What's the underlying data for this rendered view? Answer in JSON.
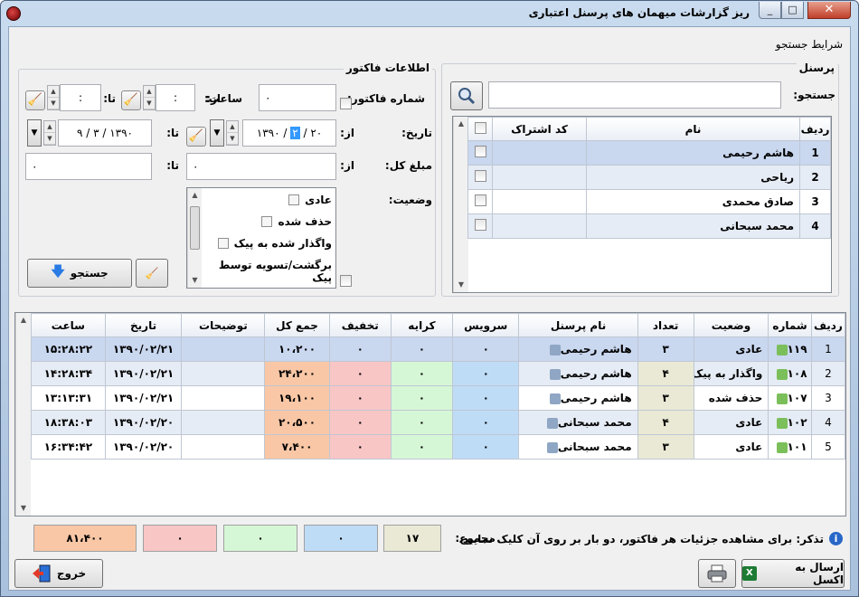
{
  "window": {
    "title": "ریز گزارشات میهمان های پرسنل اعتباری",
    "min": "_",
    "max": "□",
    "close": "✕"
  },
  "search_group": {
    "title": "شرایط جستجو"
  },
  "personnel": {
    "title": "پرسنل",
    "search_label": "جستجو:",
    "search_value": "",
    "columns": {
      "row": "ردیف",
      "name": "نام",
      "sub_code": "کد اشتراک"
    },
    "rows": [
      {
        "row": "1",
        "name": "هاشم رحیمی"
      },
      {
        "row": "2",
        "name": "ریاحی"
      },
      {
        "row": "3",
        "name": "صادق محمدی"
      },
      {
        "row": "4",
        "name": "محمد سبحانی"
      }
    ]
  },
  "invoice": {
    "title": "اطلاعات فاکتور",
    "number_label": "شماره فاکتور:",
    "number_value": "۰",
    "time_label": "ساعت:",
    "from_label": "از:",
    "to_label": "تا:",
    "time_from": ":",
    "time_to": ":",
    "date_label": "تاریخ:",
    "date_from_day": "۲۰",
    "date_from_month": "۲",
    "date_from_year": "۱۳۹۰",
    "date_to": "۹ / ۳ / ۱۳۹۰",
    "amount_label": "مبلغ کل:",
    "amount_from": "۰",
    "amount_to": "۰",
    "status_label": "وضعیت:",
    "status_options": [
      "عادی",
      "حذف شده",
      "واگذار شده به پیک",
      "برگشت/تسویه توسط پیک"
    ],
    "search_button": "جستجو"
  },
  "results": {
    "columns": [
      "ردیف",
      "شماره",
      "وضعیت",
      "تعداد",
      "نام پرسنل",
      "سرویس",
      "کرایه",
      "تخفیف",
      "جمع کل",
      "توضیحات",
      "تاریخ",
      "ساعت"
    ],
    "rows": [
      {
        "row": "1",
        "number": "۱۱۹",
        "status": "عادی",
        "count": "۳",
        "name": "هاشم رحیمی",
        "service": "۰",
        "fare": "۰",
        "discount": "۰",
        "total": "۱۰،۲۰۰",
        "desc": "",
        "date": "۱۳۹۰/۰۲/۲۱",
        "time": "۱۵:۲۸:۲۲"
      },
      {
        "row": "2",
        "number": "۱۰۸",
        "status": "واگذار به پیک",
        "count": "۴",
        "name": "هاشم رحیمی",
        "service": "۰",
        "fare": "۰",
        "discount": "۰",
        "total": "۲۴،۲۰۰",
        "desc": "",
        "date": "۱۳۹۰/۰۲/۲۱",
        "time": "۱۴:۲۸:۳۴"
      },
      {
        "row": "3",
        "number": "۱۰۷",
        "status": "حذف شده",
        "count": "۳",
        "name": "هاشم رحیمی",
        "service": "۰",
        "fare": "۰",
        "discount": "۰",
        "total": "۱۹،۱۰۰",
        "desc": "",
        "date": "۱۳۹۰/۰۲/۲۱",
        "time": "۱۳:۱۳:۳۱"
      },
      {
        "row": "4",
        "number": "۱۰۲",
        "status": "عادی",
        "count": "۴",
        "name": "محمد سبحانی",
        "service": "۰",
        "fare": "۰",
        "discount": "۰",
        "total": "۲۰،۵۰۰",
        "desc": "",
        "date": "۱۳۹۰/۰۲/۲۰",
        "time": "۱۸:۳۸:۰۳"
      },
      {
        "row": "5",
        "number": "۱۰۱",
        "status": "عادی",
        "count": "۳",
        "name": "محمد سبحانی",
        "service": "۰",
        "fare": "۰",
        "discount": "۰",
        "total": "۷،۴۰۰",
        "desc": "",
        "date": "۱۳۹۰/۰۲/۲۰",
        "time": "۱۶:۳۴:۴۲"
      }
    ]
  },
  "footer": {
    "hint": "تذکر: برای مشاهده جزئیات هر فاکتور، دو بار بر روی آن کلیک نمایید.",
    "sum_label": "مجموع:",
    "sum_count": "۱۷",
    "sum_service": "۰",
    "sum_fare": "۰",
    "sum_discount": "۰",
    "sum_total": "۸۱،۴۰۰",
    "excel_button": "ارسال به اکسل",
    "exit_button": "خروج"
  },
  "colors": {
    "service": "#bfdcf7",
    "fare": "#d6f7d6",
    "discount": "#f9c6c6",
    "total": "#f9c7a6",
    "count": "#e9e9d6"
  }
}
